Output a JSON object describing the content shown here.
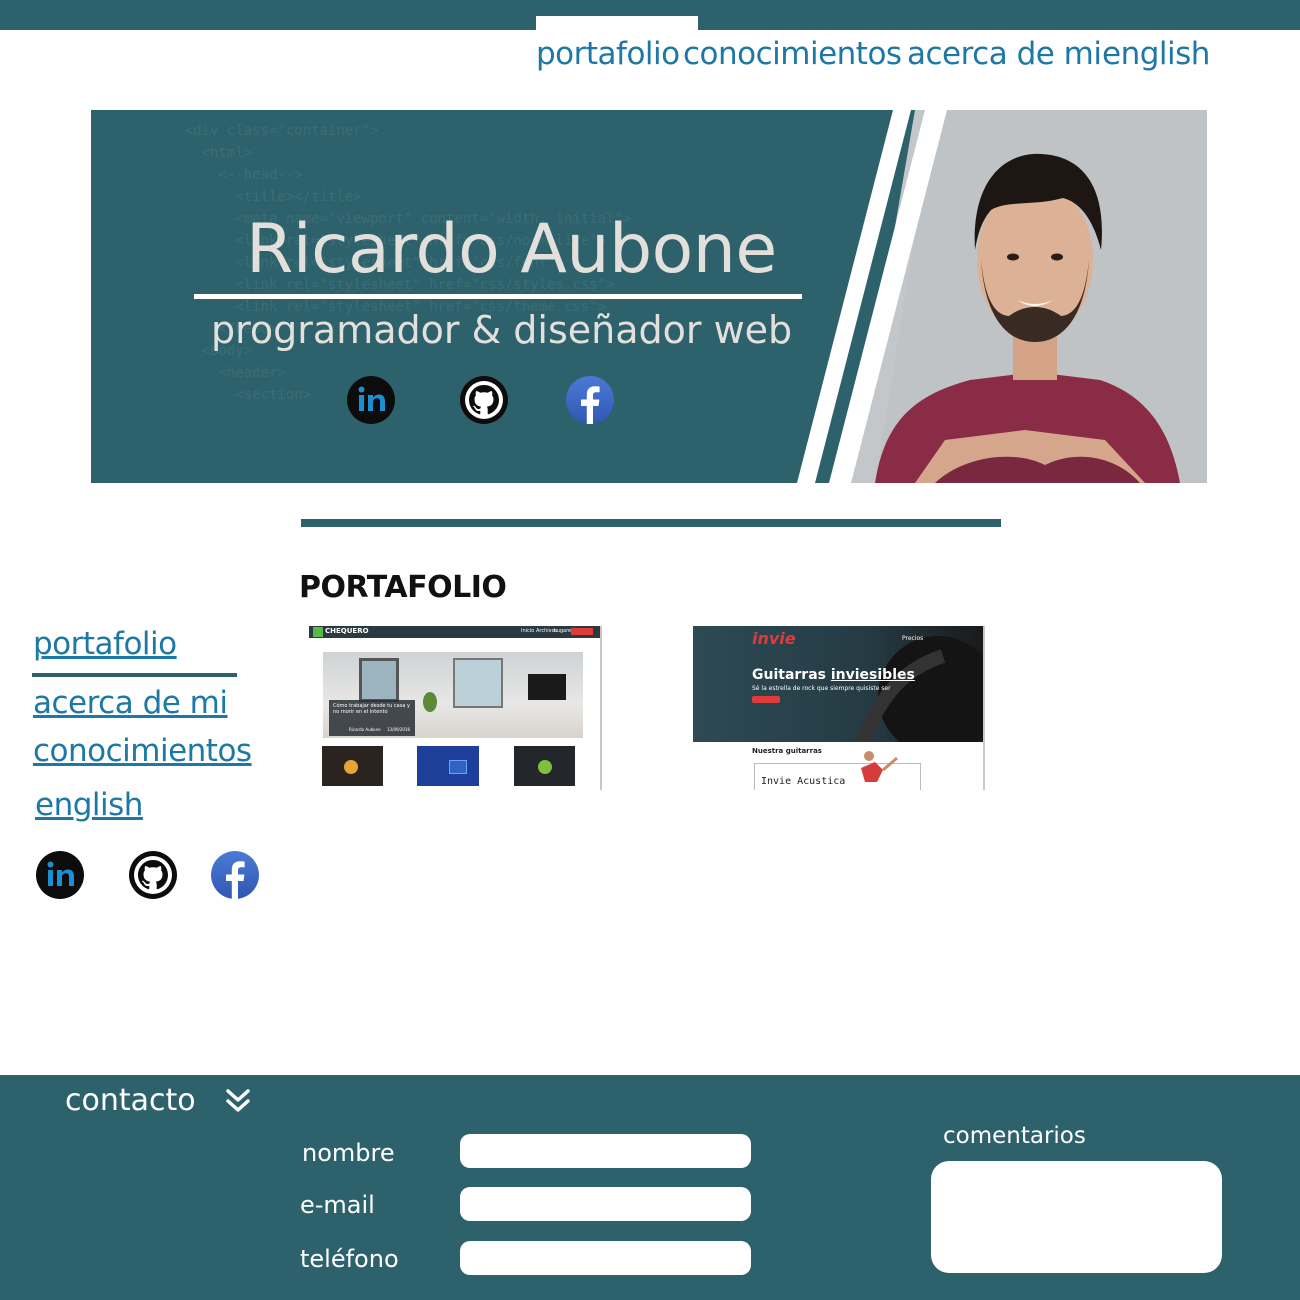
{
  "top_nav": {
    "items": [
      {
        "label": "portafolio"
      },
      {
        "label": "conocimientos"
      },
      {
        "label": "acerca de mi"
      },
      {
        "label": "english"
      }
    ]
  },
  "hero": {
    "name": "Ricardo Aubone",
    "role": "programador & diseñador web",
    "social": [
      "linkedin-icon",
      "github-icon",
      "facebook-icon"
    ]
  },
  "portfolio": {
    "title": "PORTAFOLIO",
    "projects": [
      {
        "brand": "CHEQUERO",
        "nav": [
          "Inicio",
          "Archivos",
          "Lugares"
        ],
        "card_text": "Cómo trabajar desde tu casa y no morir en el intento",
        "author": "Ricardo Aubone",
        "date": "13/09/2016"
      },
      {
        "brand": "invie",
        "nav": [
          "Precios"
        ],
        "headline_pre": "Guitarras ",
        "headline_mark": "inviesibles",
        "tagline": "Sé la estrella de rock que siempre quisiste ser",
        "section": "Nuestra guitarras",
        "card": "Invie Acustica"
      }
    ]
  },
  "sidebar": {
    "items": [
      {
        "label": "portafolio"
      },
      {
        "label": "acerca de mi"
      },
      {
        "label": "conocimientos"
      },
      {
        "label": "english"
      }
    ]
  },
  "footer": {
    "title": "contacto",
    "fields": [
      {
        "label": "nombre"
      },
      {
        "label": "e-mail"
      },
      {
        "label": "teléfono"
      }
    ],
    "comments_label": "comentarios"
  },
  "colors": {
    "primary": "#2d626c",
    "link": "#1d78a5",
    "white": "#ffffff"
  }
}
